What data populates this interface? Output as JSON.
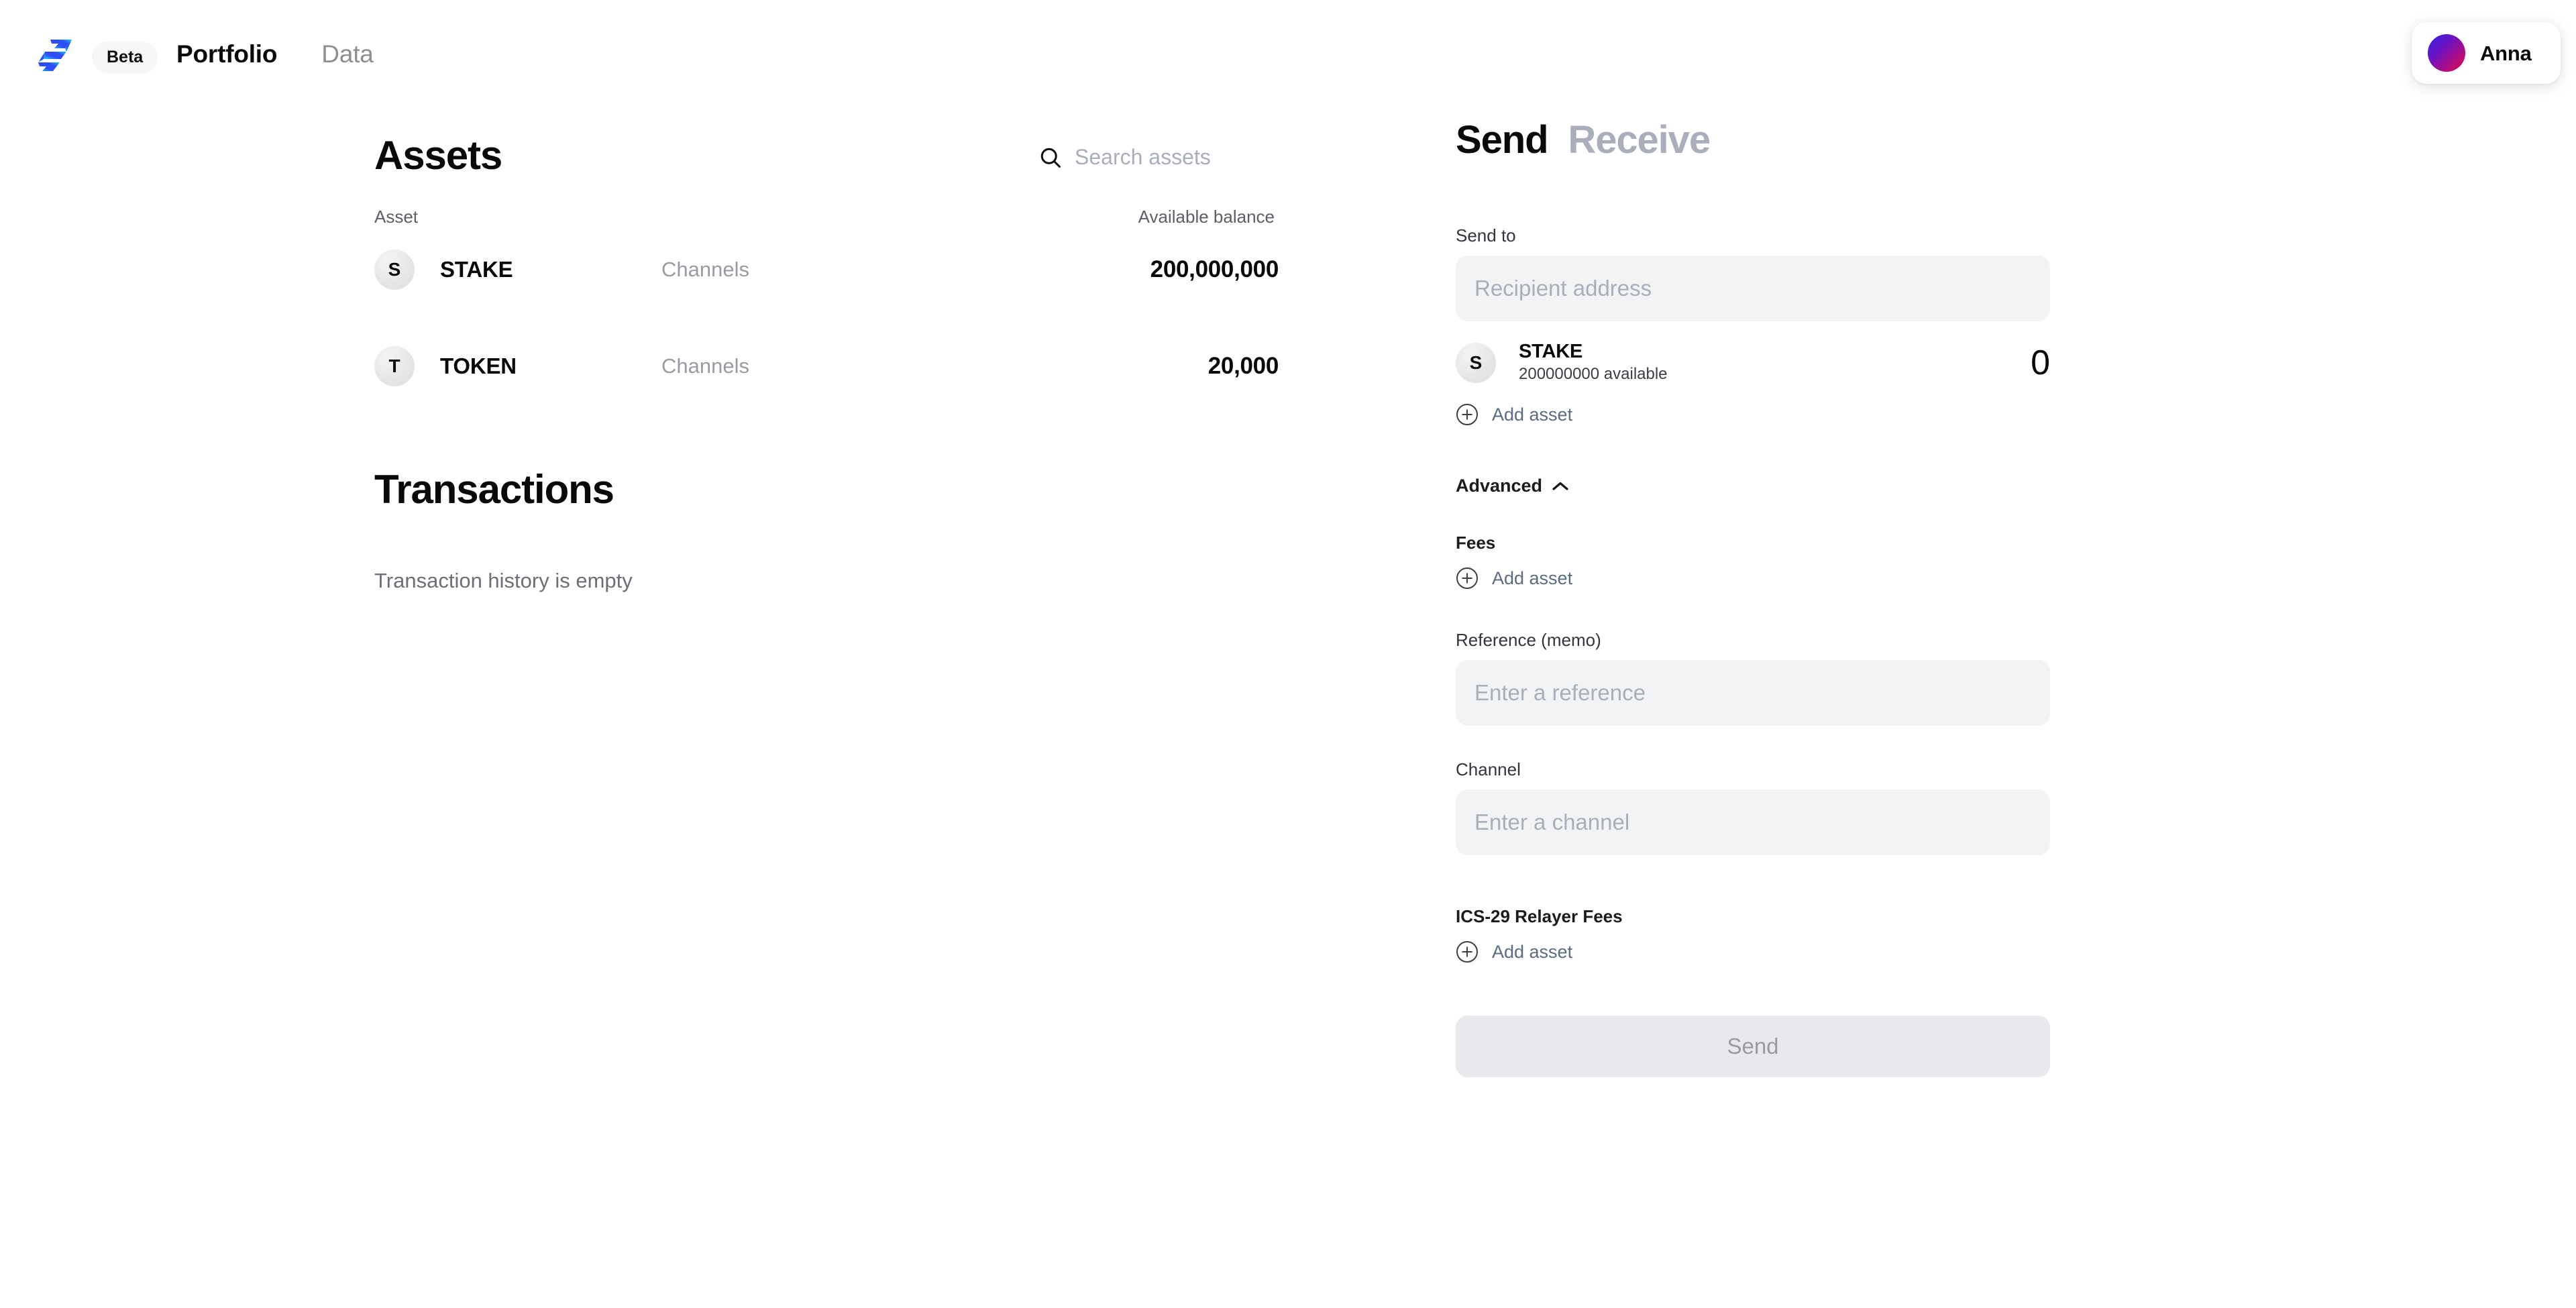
{
  "topbar": {
    "logo_icon": "stargaze-s-logo-icon",
    "beta_badge": "Beta",
    "nav": [
      {
        "label": "Portfolio",
        "state": "active"
      },
      {
        "label": "Data",
        "state": "inactive"
      }
    ],
    "account": {
      "name": "Anna",
      "avatar_icon": "user-avatar-gradient"
    }
  },
  "assets": {
    "title": "Assets",
    "search": {
      "icon": "search-icon",
      "placeholder": "Search assets",
      "value": ""
    },
    "columns": {
      "asset": "Asset",
      "balance": "Available balance"
    },
    "rows": [
      {
        "initial": "S",
        "symbol": "STAKE",
        "channels": "Channels",
        "balance": "200,000,000"
      },
      {
        "initial": "T",
        "symbol": "TOKEN",
        "channels": "Channels",
        "balance": "20,000"
      }
    ]
  },
  "transactions": {
    "title": "Transactions",
    "empty_message": "Transaction history is empty"
  },
  "send_form": {
    "tabs": [
      {
        "label": "Send",
        "state": "active"
      },
      {
        "label": "Receive",
        "state": "inactive"
      }
    ],
    "send_to": {
      "label": "Send to",
      "placeholder": "Recipient address",
      "value": ""
    },
    "amount_asset": {
      "initial": "S",
      "symbol": "STAKE",
      "available": "200000000 available",
      "amount": "0"
    },
    "add_asset_label": "Add asset",
    "add_asset_icon": "plus-circle-icon",
    "advanced": {
      "label": "Advanced",
      "icon": "chevron-up-icon",
      "expanded": true
    },
    "fees": {
      "label": "Fees",
      "add_asset_label": "Add asset"
    },
    "reference": {
      "label": "Reference (memo)",
      "placeholder": "Enter a reference",
      "value": ""
    },
    "channel": {
      "label": "Channel",
      "placeholder": "Enter a channel",
      "value": ""
    },
    "relayer_fees": {
      "label": "ICS-29 Relayer Fees",
      "add_asset_label": "Add asset"
    },
    "submit": {
      "label": "Send",
      "disabled": true
    }
  },
  "colors": {
    "accent_blue": "#2f4df5",
    "accent_cyan": "#1ac7f0",
    "avatar_start": "#3a24e0",
    "avatar_end": "#e00b3f",
    "input_bg": "#f2f3f5",
    "muted_text": "#a9aeba"
  }
}
